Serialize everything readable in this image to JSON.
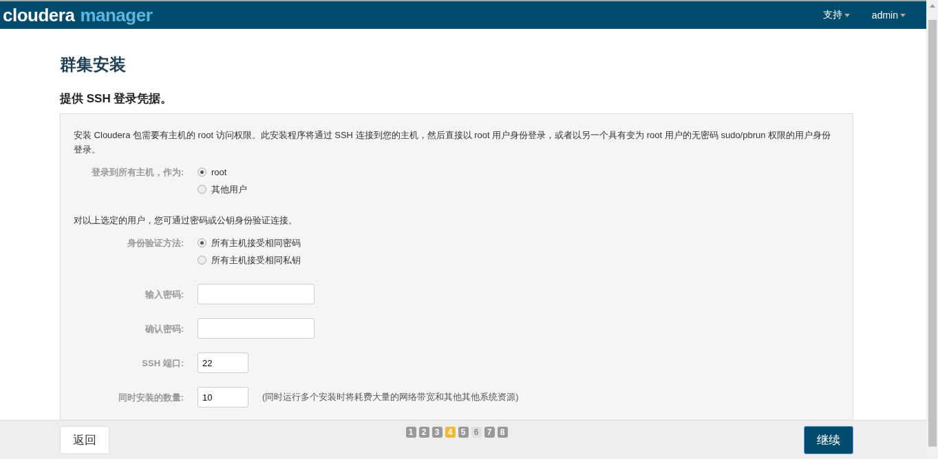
{
  "header": {
    "logo_word": "cloudera",
    "logo_product": "manager",
    "menus": [
      {
        "label": "支持"
      },
      {
        "label": "admin"
      }
    ]
  },
  "page_title": "群集安装",
  "section_title": "提供 SSH 登录凭据。",
  "intro": "安装 Cloudera 包需要有主机的 root 访问权限。此安装程序将通过 SSH 连接到您的主机，然后直接以 root 用户身份登录，或者以另一个具有变为 root 用户的无密码 sudo/pbrun 权限的用户身份登录。",
  "login_as": {
    "label": "登录到所有主机，作为:",
    "options": [
      {
        "label": "root",
        "selected": true
      },
      {
        "label": "其他用户",
        "selected": false
      }
    ]
  },
  "auth_note": "对以上选定的用户，您可通过密码或公钥身份验证连接。",
  "auth_method": {
    "label": "身份验证方法:",
    "options": [
      {
        "label": "所有主机接受相同密码",
        "selected": true
      },
      {
        "label": "所有主机接受相同私钥",
        "selected": false
      }
    ]
  },
  "fields": [
    {
      "label": "输入密码:",
      "kind": "password"
    },
    {
      "label": "确认密码:",
      "kind": "password"
    },
    {
      "label": "SSH 端口:",
      "kind": "number",
      "value": "22"
    },
    {
      "label": "同时安装的数量:",
      "kind": "number",
      "value": "10",
      "hint": "(同时运行多个安装时将耗费大量的网络带宽和其他其他系统资源)"
    }
  ],
  "footer": {
    "back": "返回",
    "continue": "继续",
    "steps": [
      {
        "label": "1",
        "kind": "done"
      },
      {
        "label": "2",
        "kind": "done"
      },
      {
        "label": "3",
        "kind": "done"
      },
      {
        "label": "4",
        "kind": "current"
      },
      {
        "label": "5",
        "kind": "done"
      },
      {
        "label": "6",
        "kind": "pending"
      },
      {
        "label": "7",
        "kind": "done"
      },
      {
        "label": "8",
        "kind": "done"
      }
    ]
  }
}
